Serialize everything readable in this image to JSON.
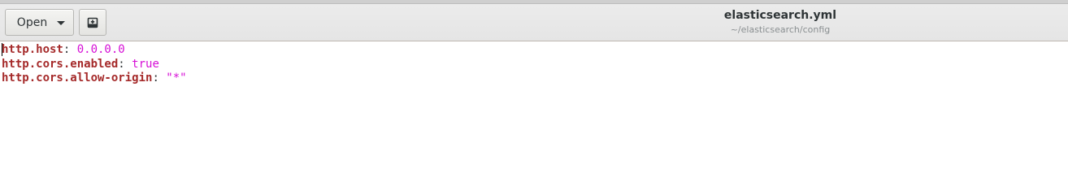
{
  "headerbar": {
    "open_label": "Open",
    "open_icon": "chevron-down-icon",
    "new_document_icon": "new-document-icon",
    "title": "elasticsearch.yml",
    "subtitle": "~/elasticsearch/config"
  },
  "editor": {
    "lines": [
      {
        "key": "http.host",
        "sep": ": ",
        "value": "0.0.0.0"
      },
      {
        "key": "http.cors.enabled",
        "sep": ": ",
        "value": "true"
      },
      {
        "key": "http.cors.allow-origin",
        "sep": ": ",
        "value": "\"*\""
      }
    ]
  },
  "colors": {
    "key": "#a52a2a",
    "value": "#d60fd6",
    "headerbar_bg": "#e8e8e7"
  }
}
